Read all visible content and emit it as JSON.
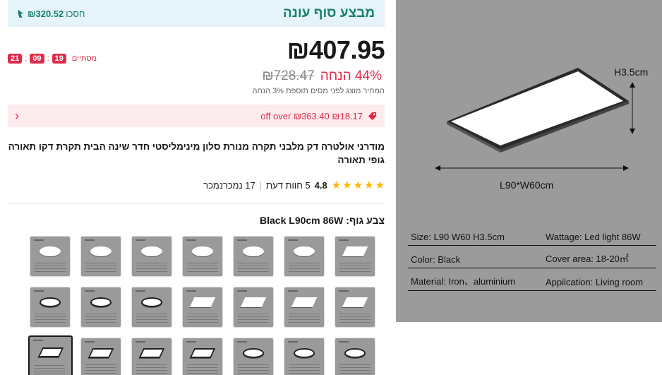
{
  "deal": {
    "title": "מבצע סוף עונה",
    "save_label": "חסכו",
    "save_amount": "₪320.52"
  },
  "price": {
    "current": "₪407.95",
    "original": "₪728.47",
    "discount": "44% הנחה",
    "tax_note": "המחיר מוצג לפני מסים תוספת 3% הנחה"
  },
  "timer": {
    "label": "מסתיים",
    "hours": "19",
    "minutes": "09",
    "seconds": "21"
  },
  "coupon": {
    "text": "₪18.17 off over ₪363.40",
    "arrow": "‹"
  },
  "product": {
    "title": "מודרני אולטרה דק מלבני תקרה מנורת סלון מינימליסטי חדר שינה הבית תקרת דקו תאורה גופי תאורה"
  },
  "rating": {
    "score": "4.8",
    "reviews": "5 חוות דעת",
    "divider": "|",
    "sold": "17 נמכרנמכר"
  },
  "variants": {
    "label": "צבע גוף: Black L90cm 86W",
    "items": [
      {
        "shape": "round",
        "frame": "white"
      },
      {
        "shape": "round",
        "frame": "white"
      },
      {
        "shape": "round",
        "frame": "white"
      },
      {
        "shape": "round",
        "frame": "white"
      },
      {
        "shape": "round",
        "frame": "white"
      },
      {
        "shape": "round",
        "frame": "white"
      },
      {
        "shape": "rect",
        "frame": "white"
      },
      {
        "shape": "round",
        "frame": "black"
      },
      {
        "shape": "round",
        "frame": "black"
      },
      {
        "shape": "round",
        "frame": "black"
      },
      {
        "shape": "rect",
        "frame": "white"
      },
      {
        "shape": "rect",
        "frame": "white"
      },
      {
        "shape": "rect",
        "frame": "white"
      },
      {
        "shape": "rect",
        "frame": "white"
      },
      {
        "shape": "rect",
        "frame": "black",
        "selected": true
      },
      {
        "shape": "rect",
        "frame": "black"
      },
      {
        "shape": "rect",
        "frame": "black"
      },
      {
        "shape": "rect",
        "frame": "black"
      },
      {
        "shape": "round",
        "frame": "black"
      },
      {
        "shape": "round",
        "frame": "black"
      },
      {
        "shape": "round",
        "frame": "black"
      }
    ]
  },
  "gallery": {
    "height_label": "H3.5cm",
    "size_label": "L90*W60cm",
    "specs": [
      [
        "Size: L90 W60 H3.5cm",
        "Wattage: Led light 86W"
      ],
      [
        "Color: Black",
        "Cover area: 18-20㎡"
      ],
      [
        "Material: Iron、aluminium",
        "Appilcation: Living room"
      ]
    ]
  }
}
